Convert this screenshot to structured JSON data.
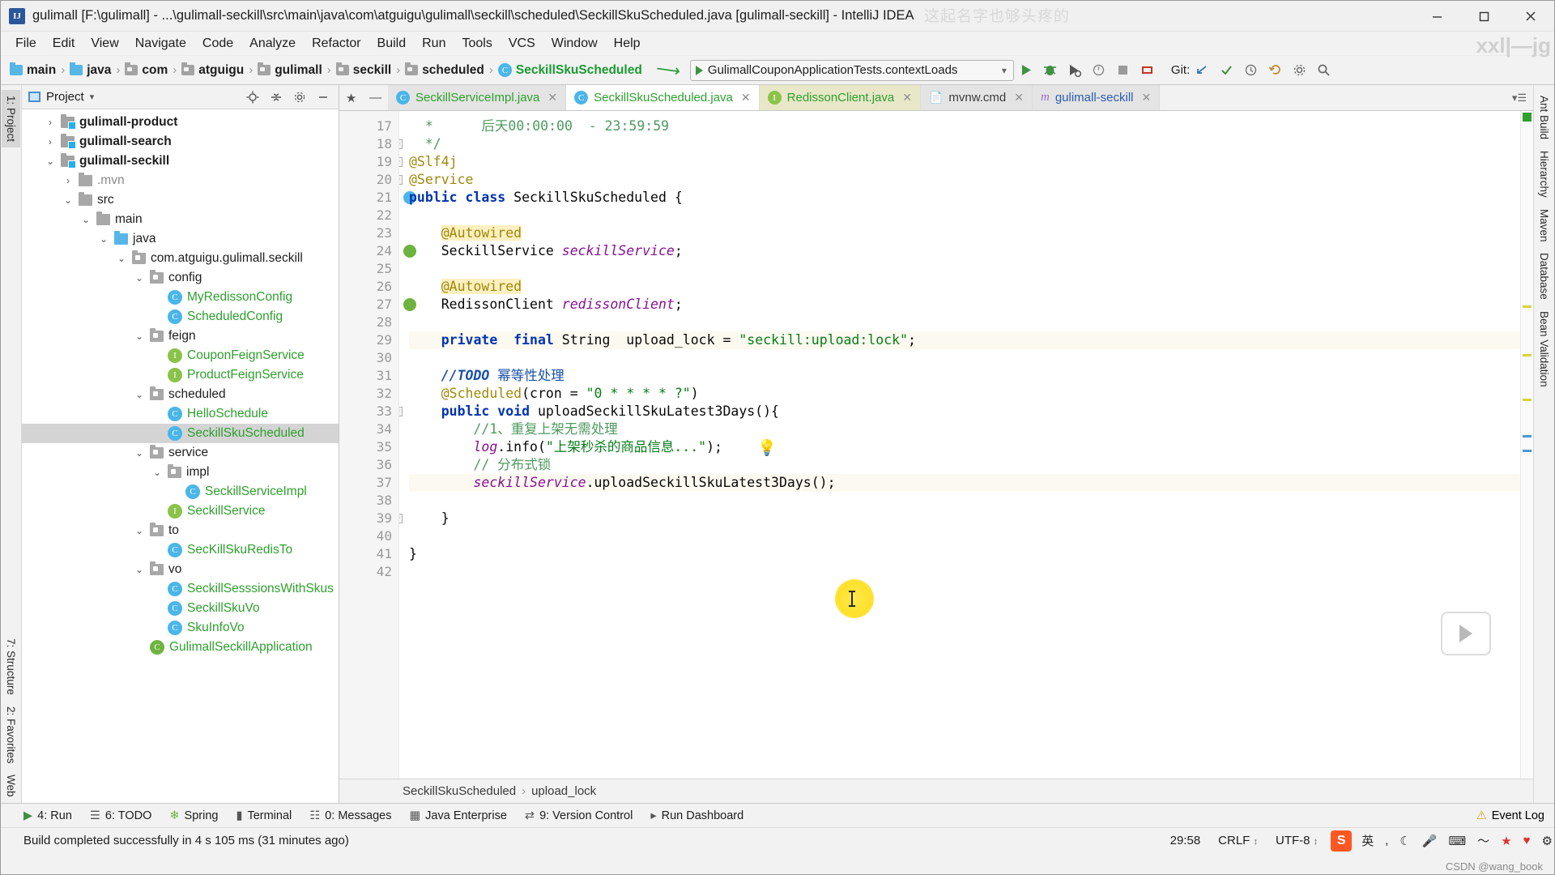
{
  "window": {
    "title": "gulimall [F:\\gulimall] - ...\\gulimall-seckill\\src\\main\\java\\com\\atguigu\\gulimall\\seckill\\scheduled\\SeckillSkuScheduled.java [gulimall-seckill] - IntelliJ IDEA",
    "app_icon_letter": "IJ",
    "minimize": "─",
    "maximize": "☐",
    "close": "✕"
  },
  "menubar": {
    "items": [
      "File",
      "Edit",
      "View",
      "Navigate",
      "Code",
      "Analyze",
      "Refactor",
      "Build",
      "Run",
      "Tools",
      "VCS",
      "Window",
      "Help"
    ]
  },
  "toolbar": {
    "breadcrumbs": [
      {
        "label": "main",
        "icon": "folder-icon",
        "kind": "folder-blue"
      },
      {
        "label": "java",
        "icon": "folder-icon",
        "kind": "folder-blue"
      },
      {
        "label": "com",
        "icon": "package-icon",
        "kind": "package"
      },
      {
        "label": "atguigu",
        "icon": "package-icon",
        "kind": "package"
      },
      {
        "label": "gulimall",
        "icon": "package-icon",
        "kind": "package"
      },
      {
        "label": "seckill",
        "icon": "package-icon",
        "kind": "package"
      },
      {
        "label": "scheduled",
        "icon": "package-icon",
        "kind": "package"
      },
      {
        "label": "SeckillSkuScheduled",
        "icon": "class-icon",
        "kind": "class"
      }
    ],
    "run_config": "GulimallCouponApplicationTests.contextLoads",
    "run_config_caret": "▾",
    "git_label": "Git:",
    "icons": [
      "run-icon",
      "debug-icon",
      "run-with-coverage-icon",
      "profile-icon",
      "stop-icon",
      "build-icon",
      "git-update-icon",
      "git-commit-icon",
      "git-history-icon",
      "undo-icon",
      "settings-icon",
      "search-everywhere-icon",
      "more-icon"
    ]
  },
  "editor_tabs": [
    {
      "label": "SeckillServiceImpl.java",
      "icon": "class-icon",
      "color": "green",
      "active": false,
      "close": "✕"
    },
    {
      "label": "SeckillSkuScheduled.java",
      "icon": "class-icon",
      "color": "green",
      "active": true,
      "close": "✕"
    },
    {
      "label": "RedissonClient.java",
      "icon": "interface-icon",
      "color": "green",
      "active": false,
      "close": "✕"
    },
    {
      "label": "mvnw.cmd",
      "icon": "file-icon",
      "color": "gray",
      "active": false,
      "close": "✕"
    },
    {
      "label": "gulimall-seckill",
      "icon": "maven-icon",
      "color": "blue",
      "active": false,
      "close": "✕"
    }
  ],
  "sidebar_left_tabs": [
    {
      "label": "1: Project",
      "selected": true
    },
    {
      "label": "7: Structure",
      "selected": false
    },
    {
      "label": "2: Favorites",
      "selected": false
    },
    {
      "label": "Web",
      "selected": false
    }
  ],
  "sidebar_right_tabs": [
    {
      "label": "Ant Build"
    },
    {
      "label": "Hierarchy"
    },
    {
      "label": "Maven"
    },
    {
      "label": "Database"
    },
    {
      "label": "Bean Validation"
    }
  ],
  "project_panel": {
    "title": "Project",
    "caret": "▾",
    "icons": [
      "locate-icon",
      "collapse-all-icon",
      "settings-icon",
      "hide-icon"
    ],
    "tree": [
      {
        "label": "gulimall-product",
        "indent": 1,
        "twisty": "›",
        "icon": "module-icon",
        "style": "bold"
      },
      {
        "label": "gulimall-search",
        "indent": 1,
        "twisty": "›",
        "icon": "module-icon",
        "style": "bold"
      },
      {
        "label": "gulimall-seckill",
        "indent": 1,
        "twisty": "⌄",
        "icon": "module-icon",
        "style": "bold"
      },
      {
        "label": ".mvn",
        "indent": 2,
        "twisty": "›",
        "icon": "folder-icon",
        "style": "dim"
      },
      {
        "label": "src",
        "indent": 2,
        "twisty": "⌄",
        "icon": "folder-icon",
        "style": "plain"
      },
      {
        "label": "main",
        "indent": 3,
        "twisty": "⌄",
        "icon": "folder-icon",
        "style": "plain"
      },
      {
        "label": "java",
        "indent": 4,
        "twisty": "⌄",
        "icon": "source-folder-icon",
        "style": "plain"
      },
      {
        "label": "com.atguigu.gulimall.seckill",
        "indent": 5,
        "twisty": "⌄",
        "icon": "package-icon",
        "style": "plain"
      },
      {
        "label": "config",
        "indent": 6,
        "twisty": "⌄",
        "icon": "package-icon",
        "style": "plain"
      },
      {
        "label": "MyRedissonConfig",
        "indent": 7,
        "twisty": "",
        "icon": "class-icon",
        "style": "green"
      },
      {
        "label": "ScheduledConfig",
        "indent": 7,
        "twisty": "",
        "icon": "class-icon",
        "style": "green"
      },
      {
        "label": "feign",
        "indent": 6,
        "twisty": "⌄",
        "icon": "package-icon",
        "style": "plain"
      },
      {
        "label": "CouponFeignService",
        "indent": 7,
        "twisty": "",
        "icon": "interface-icon",
        "style": "green"
      },
      {
        "label": "ProductFeignService",
        "indent": 7,
        "twisty": "",
        "icon": "interface-icon",
        "style": "green"
      },
      {
        "label": "scheduled",
        "indent": 6,
        "twisty": "⌄",
        "icon": "package-icon",
        "style": "plain"
      },
      {
        "label": "HelloSchedule",
        "indent": 7,
        "twisty": "",
        "icon": "class-icon",
        "style": "green"
      },
      {
        "label": "SeckillSkuScheduled",
        "indent": 7,
        "twisty": "",
        "icon": "class-icon",
        "style": "green",
        "selected": true
      },
      {
        "label": "service",
        "indent": 6,
        "twisty": "⌄",
        "icon": "package-icon",
        "style": "plain"
      },
      {
        "label": "impl",
        "indent": 7,
        "twisty": "⌄",
        "icon": "package-icon",
        "style": "plain"
      },
      {
        "label": "SeckillServiceImpl",
        "indent": 8,
        "twisty": "",
        "icon": "class-icon",
        "style": "green"
      },
      {
        "label": "SeckillService",
        "indent": 7,
        "twisty": "",
        "icon": "interface-icon",
        "style": "green"
      },
      {
        "label": "to",
        "indent": 6,
        "twisty": "⌄",
        "icon": "package-icon",
        "style": "plain"
      },
      {
        "label": "SecKillSkuRedisTo",
        "indent": 7,
        "twisty": "",
        "icon": "class-icon",
        "style": "green"
      },
      {
        "label": "vo",
        "indent": 6,
        "twisty": "⌄",
        "icon": "package-icon",
        "style": "plain"
      },
      {
        "label": "SeckillSesssionsWithSkus",
        "indent": 7,
        "twisty": "",
        "icon": "class-icon",
        "style": "green"
      },
      {
        "label": "SeckillSkuVo",
        "indent": 7,
        "twisty": "",
        "icon": "class-icon",
        "style": "green"
      },
      {
        "label": "SkuInfoVo",
        "indent": 7,
        "twisty": "",
        "icon": "class-icon",
        "style": "green"
      },
      {
        "label": "GulimallSeckillApplication",
        "indent": 6,
        "twisty": "",
        "icon": "spring-class-icon",
        "style": "green"
      }
    ]
  },
  "code": {
    "first_line_number": 17,
    "lines": [
      {
        "n": 17,
        "html": "  <span class='cmt-green'>*      后天00:00:00  - 23:59:59</span>"
      },
      {
        "n": 18,
        "html": "  <span class='cmt-green'>*/</span>",
        "fold": "−"
      },
      {
        "n": 19,
        "html": "<span class='anno'>@Slf4j</span>",
        "fold": "−"
      },
      {
        "n": 20,
        "html": "<span class='anno'>@Service</span>",
        "fold": "−"
      },
      {
        "n": 21,
        "html": "<span class='kw'>public class</span> <span class='plain'>SeckillSkuScheduled</span> <span class='plain'>{</span>",
        "mark": "class-gutter-icon"
      },
      {
        "n": 22,
        "html": ""
      },
      {
        "n": 23,
        "html": "    <span class='annohl'>@Autowired</span>"
      },
      {
        "n": 24,
        "html": "    <span class='plain'>SeckillService</span> <span class='fld'>seckillService</span><span class='plain'>;</span>",
        "mark": "bean-gutter-icon"
      },
      {
        "n": 25,
        "html": ""
      },
      {
        "n": 26,
        "html": "    <span class='annohl'>@Autowired</span>"
      },
      {
        "n": 27,
        "html": "    <span class='plain'>RedissonClient</span> <span class='fld'>redissonClient</span><span class='plain'>;</span>",
        "mark": "bean-gutter-icon"
      },
      {
        "n": 28,
        "html": ""
      },
      {
        "n": 29,
        "html": "    <span class='kw'>private</span>  <span class='kw'>final</span> <span class='plain'>String</span>  <span class='plain'>upload_lock</span> <span class='plain'>=</span> <span class='str'>\"seckill:upload:lock\"</span><span class='plain'>;</span>",
        "mark": "intention-bulb-icon",
        "highlight": true
      },
      {
        "n": 30,
        "html": ""
      },
      {
        "n": 31,
        "html": "    <span class='todo'>//TODO</span> <span class='todo-txt'>幂等性处理</span>"
      },
      {
        "n": 32,
        "html": "    <span class='anno'>@Scheduled</span><span class='plain'>(cron = </span><span class='str'>\"0 * * * * ?\"</span><span class='plain'>)</span>"
      },
      {
        "n": 33,
        "html": "    <span class='kw'>public void</span> <span class='plain'>uploadSeckillSkuLatest3Days(){</span>",
        "fold": "−"
      },
      {
        "n": 34,
        "html": "        <span class='cmt-green'>//1、重复上架无需处理</span>"
      },
      {
        "n": 35,
        "html": "        <span class='fld'>log</span><span class='plain'>.info(</span><span class='str'>\"上架秒杀的商品信息...\"</span><span class='plain'>);</span>"
      },
      {
        "n": 36,
        "html": "        <span class='cmt-green'>// 分布式锁</span>"
      },
      {
        "n": 37,
        "html": "        <span class='fld'>seckillService</span><span class='plain'>.uploadSeckillSkuLatest3Days();</span>",
        "highlight": true
      },
      {
        "n": 38,
        "html": ""
      },
      {
        "n": 39,
        "html": "    <span class='plain'>}</span>",
        "fold": "−"
      },
      {
        "n": 40,
        "html": ""
      },
      {
        "n": 41,
        "html": "<span class='plain'>}</span>"
      },
      {
        "n": 42,
        "html": ""
      }
    ]
  },
  "editor_breadcrumb": [
    "SeckillSkuScheduled",
    "upload_lock"
  ],
  "bottom_bar": {
    "items": [
      {
        "label": "4: Run",
        "icon": "run-icon"
      },
      {
        "label": "6: TODO",
        "icon": "todo-icon"
      },
      {
        "label": "Spring",
        "icon": "spring-icon"
      },
      {
        "label": "Terminal",
        "icon": "terminal-icon"
      },
      {
        "label": "0: Messages",
        "icon": "messages-icon"
      },
      {
        "label": "Java Enterprise",
        "icon": "java-enterprise-icon"
      },
      {
        "label": "9: Version Control",
        "icon": "version-control-icon"
      },
      {
        "label": "Run Dashboard",
        "icon": "run-dashboard-icon"
      }
    ],
    "event_log": "Event Log",
    "event_log_icon": "event-log-icon"
  },
  "status_bar": {
    "message": "Build completed successfully in 4 s 105 ms (31 minutes ago)",
    "caret_position": "29:58",
    "line_separator": "CRLF",
    "line_separator_caret": "↕",
    "encoding": "UTF-8",
    "encoding_caret": "↕",
    "ime_badge": "S",
    "ime_lang": "英",
    "tray_icons": [
      "comma-icon",
      "moon-icon",
      "mic-icon",
      "keyboard-icon",
      "wave-icon",
      "star-icon",
      "heart-icon",
      "settings-icon"
    ]
  },
  "overlays": {
    "watermark_top": "这起名字也够头疼的",
    "watermark_right": "xxl|—jg",
    "watermark_bottom": "CSDN @wang_book",
    "play_button": "play-overlay-icon"
  },
  "colors": {
    "accent_green": "#2ea02e",
    "keyword_blue": "#0033b3",
    "string_green": "#067d17",
    "annotation_gold": "#9e880d",
    "field_purple": "#871094",
    "selection_gray": "#d4d4d4"
  }
}
